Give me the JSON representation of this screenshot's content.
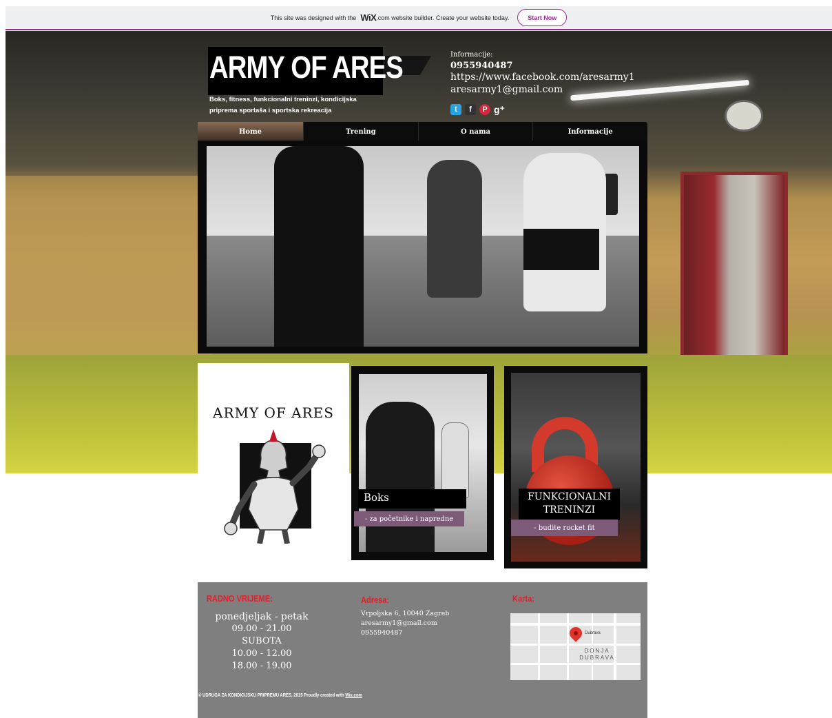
{
  "wix_banner": {
    "text_before": "This site was designed with the",
    "logo": "WiX",
    "text_after": ".com website builder. Create your website today.",
    "start_label": "Start Now",
    "accent_color": "#9b2b8e"
  },
  "header": {
    "logo_title": "ARMY OF ARES",
    "tagline": "Boks, fitness, funkcionalni treninzi, kondicijska priprema sportaša i sportska rekreacija",
    "info_label": "Informacije:",
    "phone": "0955940487",
    "facebook": "https://www.facebook.com/aresarmy1",
    "email": "aresarmy1@gmail.com",
    "social_icons": [
      "twitter-icon",
      "facebook-icon",
      "pinterest-icon",
      "google-plus-icon"
    ]
  },
  "nav": {
    "items": [
      {
        "label": "Home",
        "active": true
      },
      {
        "label": "Trening",
        "active": false
      },
      {
        "label": "O nama",
        "active": false
      },
      {
        "label": "Informacije",
        "active": false
      }
    ]
  },
  "cards": {
    "logo_card": {
      "title": "ARMY OF ARES"
    },
    "boks": {
      "title": "Boks",
      "subtitle": "- za početnike i napredne"
    },
    "funkcionalni": {
      "title": "FUNKCIONALNI TRENINZI",
      "subtitle": "- budite rocket fit"
    }
  },
  "footer": {
    "hours_heading": "RADNO VRIJEME:",
    "hours": [
      "ponedjeljak - petak",
      "09.00 - 21.00",
      "SUBOTA",
      "10.00 - 12.00",
      "18.00 - 19.00"
    ],
    "address_heading": "Adresa:",
    "address": [
      "Vrpoljska 6, 10040 Zagreb",
      "aresarmy1@gmail.com",
      "0955940487"
    ],
    "map_heading": "Karta:",
    "map_labels": {
      "place": "Dubrava",
      "district": "DONJA DUBRAVA"
    },
    "copyright_text": "© UDRUGA ZA KONDICIJSKU PRIPREMU ARES, 2015  Proudly created with ",
    "copyright_link": "Wix.com",
    "heading_color": "#e0202a"
  }
}
